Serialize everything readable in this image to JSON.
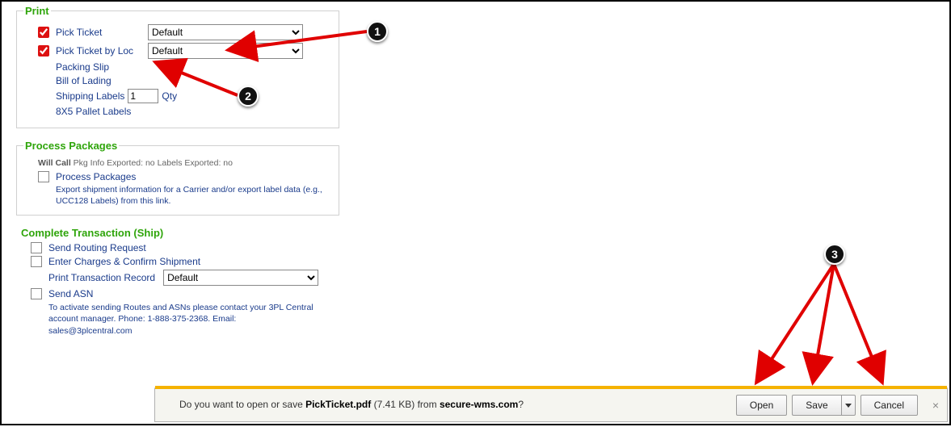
{
  "print": {
    "legend": "Print",
    "pick_ticket": {
      "label": "Pick Ticket",
      "select": "Default"
    },
    "pick_ticket_loc": {
      "label": "Pick Ticket by Loc",
      "select": "Default"
    },
    "packing_slip": "Packing Slip",
    "bill_of_lading": "Bill of Lading",
    "shipping_labels": {
      "label": "Shipping Labels",
      "qty_value": "1",
      "qty_label": "Qty"
    },
    "pallet_labels": "8X5 Pallet Labels"
  },
  "process_packages": {
    "legend": "Process Packages",
    "status_prefix": "Will Call",
    "status_rest": " Pkg Info Exported: no Labels Exported: no",
    "checkbox_label": "Process Packages",
    "desc": "Export shipment information for a Carrier and/or export label data (e.g., UCC128 Labels) from this link."
  },
  "complete": {
    "legend": "Complete Transaction (Ship)",
    "send_routing": "Send Routing Request",
    "enter_charges": "Enter Charges & Confirm Shipment",
    "print_trans": {
      "label": "Print Transaction Record",
      "select": "Default"
    },
    "send_asn": "Send ASN",
    "contact": "To activate sending Routes and ASNs please contact your 3PL Central account manager. Phone: 1-888-375-2368. Email: sales@3plcentral.com"
  },
  "download": {
    "prompt_pre": "Do you want to open or save ",
    "file": "PickTicket.pdf",
    "size": " (7.41 KB) ",
    "from": "from ",
    "host": "secure-wms.com",
    "q": "?",
    "open": "Open",
    "save": "Save",
    "cancel": "Cancel"
  },
  "callouts": {
    "one": "1",
    "two": "2",
    "three": "3"
  }
}
